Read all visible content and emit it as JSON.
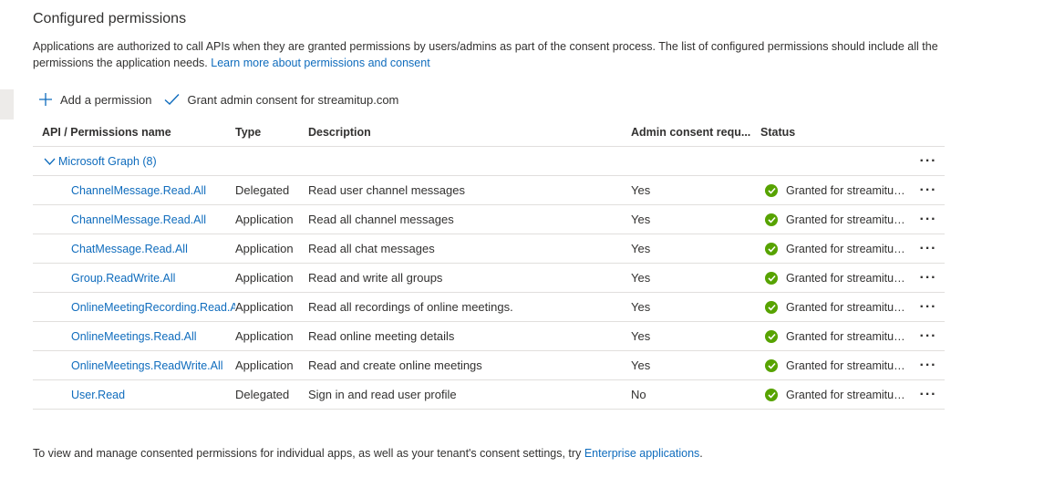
{
  "section": {
    "title": "Configured permissions",
    "description": "Applications are authorized to call APIs when they are granted permissions by users/admins as part of the consent process. The list of configured permissions should include all the permissions the application needs.",
    "learn_more": "Learn more about permissions and consent"
  },
  "toolbar": {
    "add_permission": "Add a permission",
    "grant_consent": "Grant admin consent for streamitup.com"
  },
  "table": {
    "headers": {
      "name": "API / Permissions name",
      "type": "Type",
      "description": "Description",
      "admin": "Admin consent requ...",
      "status": "Status"
    },
    "group": {
      "label": "Microsoft Graph (8)"
    },
    "rows": [
      {
        "name": "ChannelMessage.Read.All",
        "type": "Delegated",
        "description": "Read user channel messages",
        "admin": "Yes",
        "status": "Granted for streamitup...."
      },
      {
        "name": "ChannelMessage.Read.All",
        "type": "Application",
        "description": "Read all channel messages",
        "admin": "Yes",
        "status": "Granted for streamitup...."
      },
      {
        "name": "ChatMessage.Read.All",
        "type": "Application",
        "description": "Read all chat messages",
        "admin": "Yes",
        "status": "Granted for streamitup...."
      },
      {
        "name": "Group.ReadWrite.All",
        "type": "Application",
        "description": "Read and write all groups",
        "admin": "Yes",
        "status": "Granted for streamitup...."
      },
      {
        "name": "OnlineMeetingRecording.Read.A",
        "type": "Application",
        "description": "Read all recordings of online meetings.",
        "admin": "Yes",
        "status": "Granted for streamitup...."
      },
      {
        "name": "OnlineMeetings.Read.All",
        "type": "Application",
        "description": "Read online meeting details",
        "admin": "Yes",
        "status": "Granted for streamitup...."
      },
      {
        "name": "OnlineMeetings.ReadWrite.All",
        "type": "Application",
        "description": "Read and create online meetings",
        "admin": "Yes",
        "status": "Granted for streamitup...."
      },
      {
        "name": "User.Read",
        "type": "Delegated",
        "description": "Sign in and read user profile",
        "admin": "No",
        "status": "Granted for streamitup...."
      }
    ]
  },
  "footer": {
    "text": "To view and manage consented permissions for individual apps, as well as your tenant's consent settings, try",
    "link": "Enterprise applications",
    "suffix": "."
  },
  "icons": {
    "add": "plus-icon",
    "grant": "checkmark-icon",
    "expand": "chevron-down-icon",
    "status": "success-check-icon",
    "more": "more-icon"
  },
  "colors": {
    "link": "#0f6cbd",
    "success": "#57a300",
    "divider": "#e1dfdd"
  }
}
